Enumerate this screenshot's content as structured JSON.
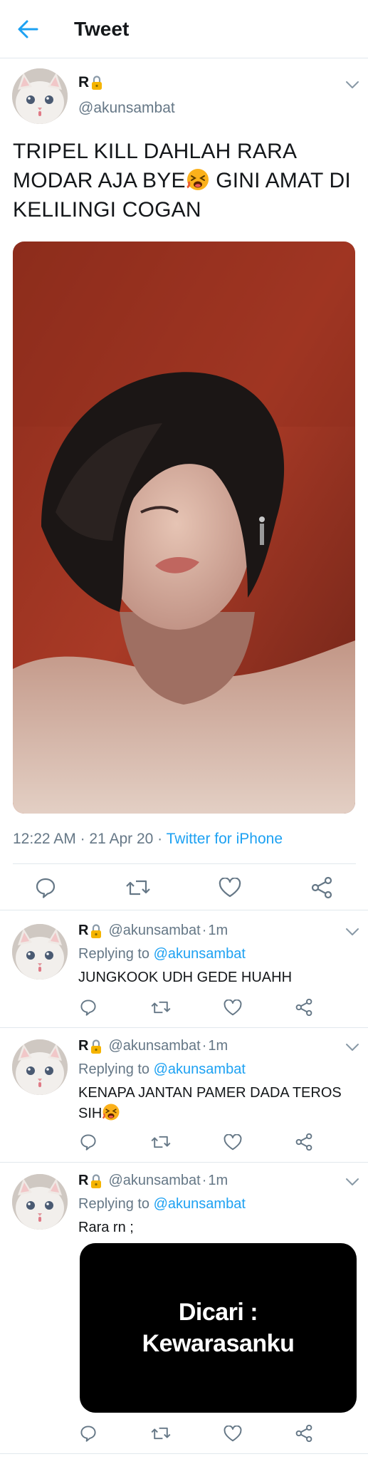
{
  "header": {
    "title": "Tweet",
    "back_icon": "arrow-left-icon"
  },
  "colors": {
    "accent": "#1da1f2",
    "secondary_text": "#657786",
    "divider": "#e1e8ed"
  },
  "main_tweet": {
    "name": "R",
    "handle": "@akunsambat",
    "text_part1": "TRIPEL KILL DAHLAH RARA MODAR AJA BYE",
    "text_part2": " GINI AMAT DI KELILINGI COGAN",
    "time": "12:22 AM",
    "date": "21 Apr 20",
    "client": "Twitter for iPhone"
  },
  "replies": [
    {
      "name": "R",
      "handle": "@akunsambat",
      "time": "1m",
      "replying_label": "Replying to",
      "replying_to": "@akunsambat",
      "text": "JUNGKOOK UDH GEDE HUAHH"
    },
    {
      "name": "R",
      "handle": "@akunsambat",
      "time": "1m",
      "replying_label": "Replying to",
      "replying_to": "@akunsambat",
      "text": "KENAPA JANTAN PAMER DADA TEROS SIH"
    },
    {
      "name": "R",
      "handle": "@akunsambat",
      "time": "1m",
      "replying_label": "Replying to",
      "replying_to": "@akunsambat",
      "text": "Rara rn ;",
      "card_text": "Dicari :\nKewarasanku"
    }
  ],
  "separator": " · "
}
